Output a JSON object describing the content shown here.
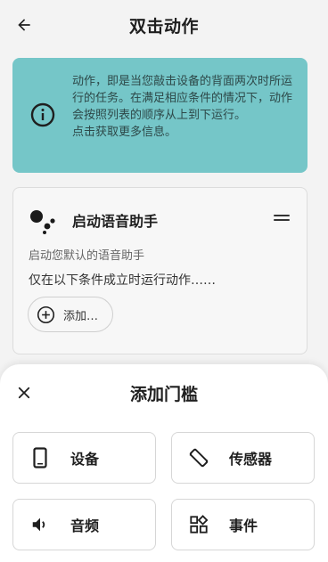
{
  "header": {
    "title": "双击动作",
    "back_icon": "arrow-left-icon"
  },
  "info": {
    "text": "动作，即是当您敲击设备的背面两次时所运行的任务。在满足相应条件的情况下，动作会按照列表的顺序从上到下运行。",
    "link": "点击获取更多信息。",
    "color": "#75c6c8"
  },
  "action_card": {
    "title": "启动语音助手",
    "description": "启动您默认的语音助手",
    "condition_text": "仅在以下条件成立时运行动作……",
    "add_label": "添加…"
  },
  "sheet": {
    "title": "添加门槛",
    "options": [
      {
        "label": "设备",
        "icon": "phone-icon"
      },
      {
        "label": "传感器",
        "icon": "screen-rotation-icon"
      },
      {
        "label": "音频",
        "icon": "volume-icon"
      },
      {
        "label": "事件",
        "icon": "widgets-icon"
      }
    ]
  }
}
